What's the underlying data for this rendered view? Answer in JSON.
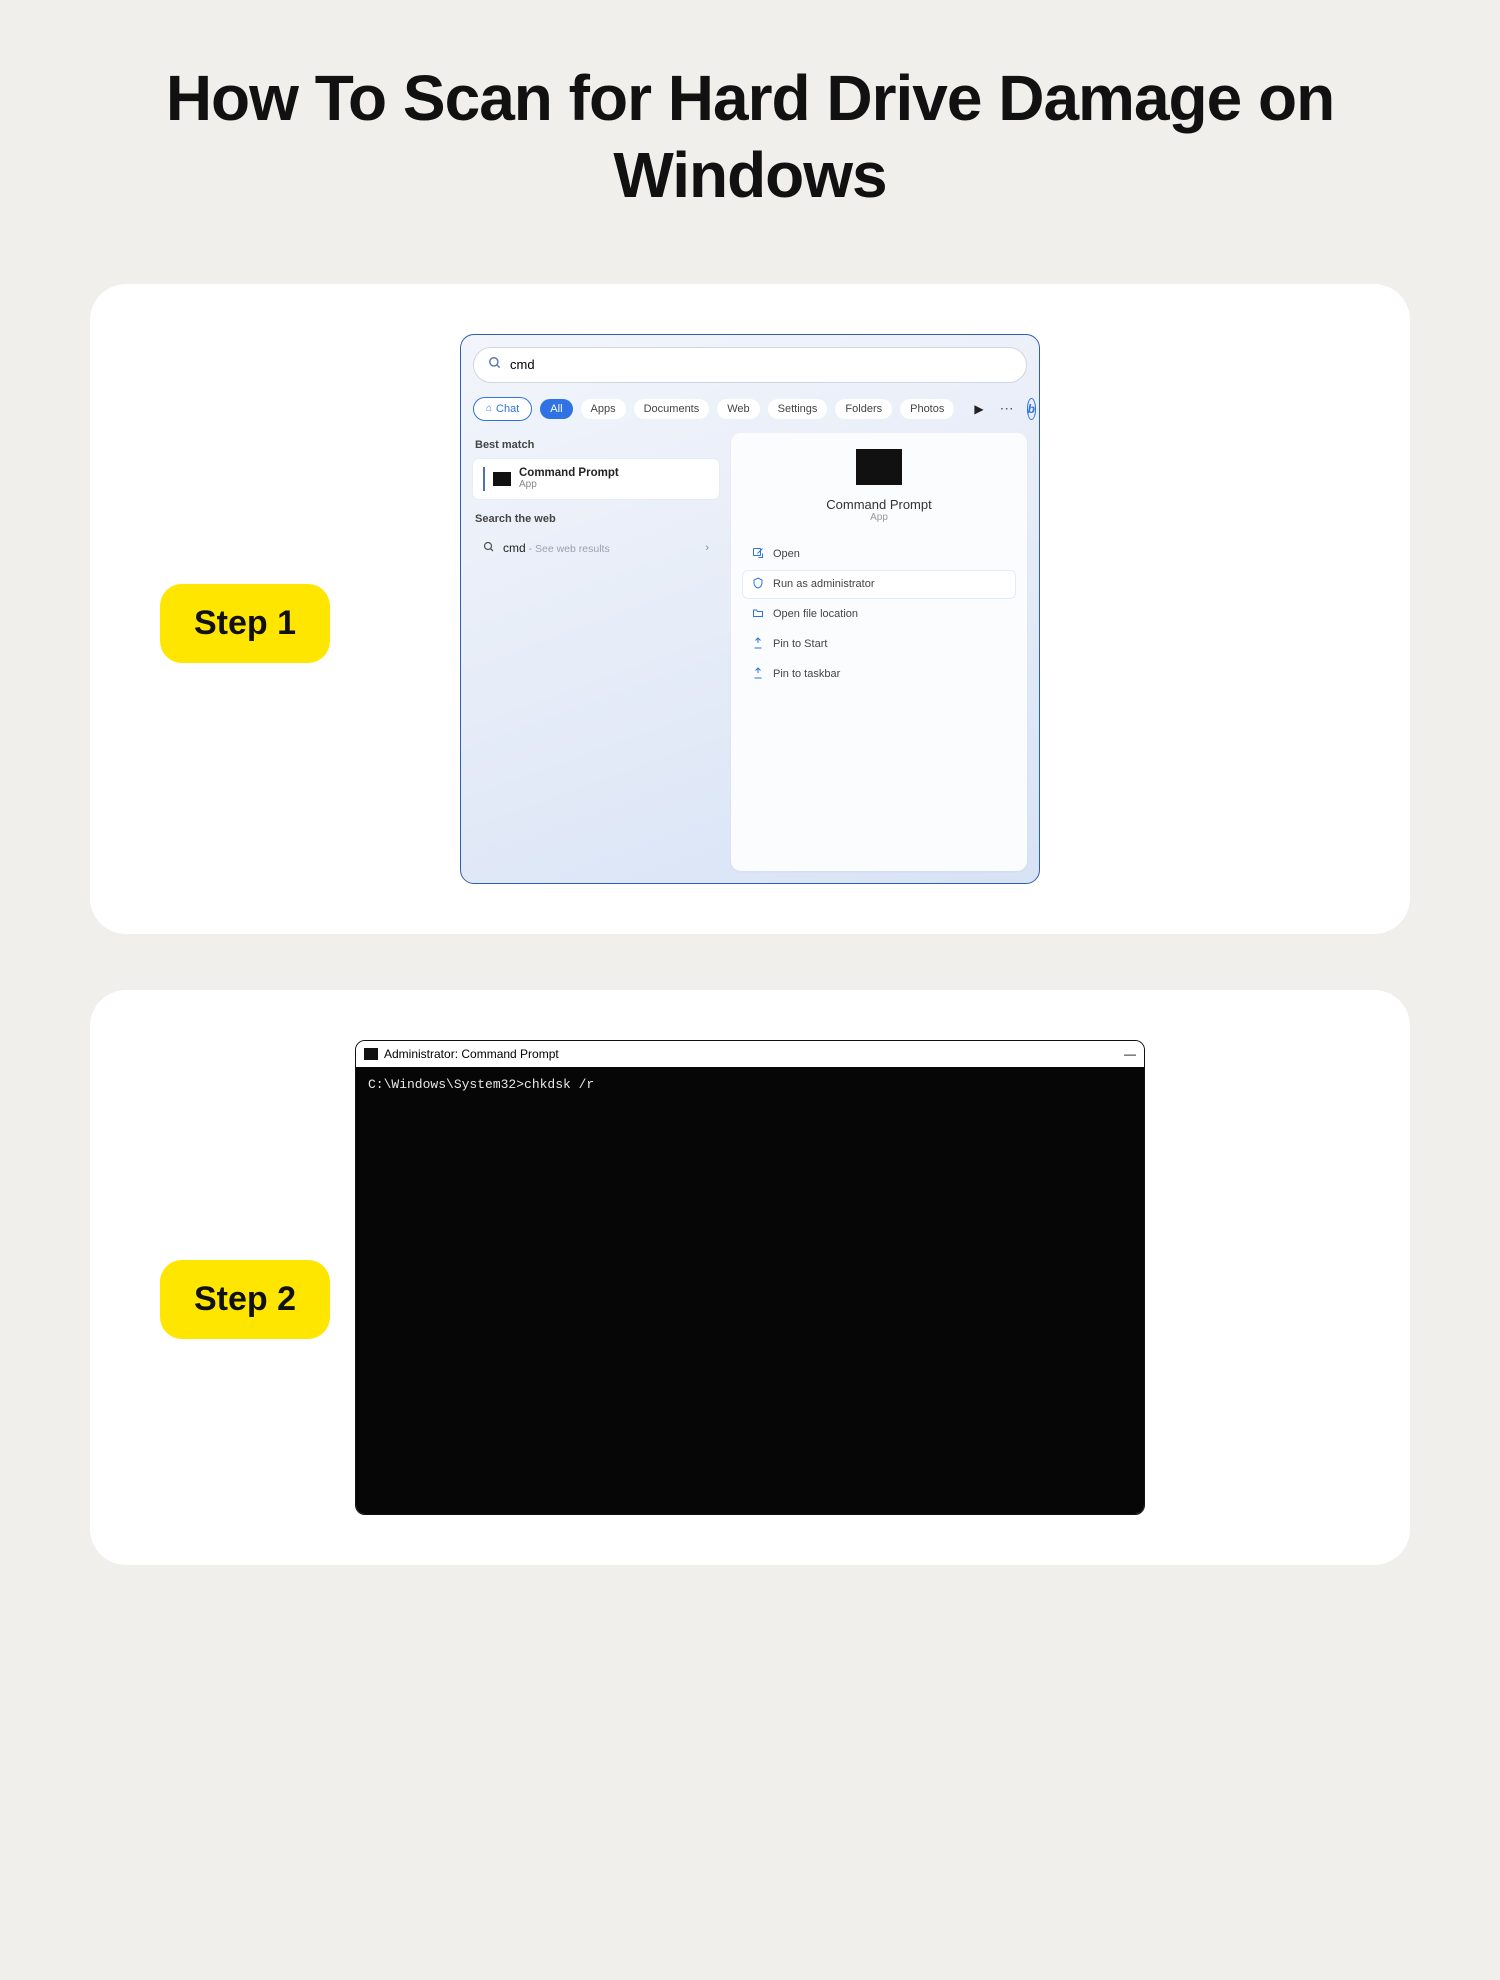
{
  "title": "How To Scan for Hard Drive Damage on Windows",
  "steps": {
    "one": "Step 1",
    "two": "Step 2"
  },
  "search": {
    "query": "cmd",
    "placeholder": "",
    "filters": {
      "chat": "Chat",
      "all": "All",
      "apps": "Apps",
      "documents": "Documents",
      "web": "Web",
      "settings": "Settings",
      "folders": "Folders",
      "photos": "Photos"
    },
    "best_match_header": "Best match",
    "best_match": {
      "title": "Command Prompt",
      "subtitle": "App"
    },
    "search_web_header": "Search the web",
    "web_result": {
      "term": "cmd",
      "hint": " - See web results"
    },
    "details": {
      "title": "Command Prompt",
      "subtitle": "App",
      "actions": {
        "open": "Open",
        "run_admin": "Run as administrator",
        "open_location": "Open file location",
        "pin_start": "Pin to Start",
        "pin_taskbar": "Pin to taskbar"
      }
    }
  },
  "terminal": {
    "title": "Administrator: Command Prompt",
    "line": "C:\\Windows\\System32>chkdsk /r",
    "close": "—"
  }
}
